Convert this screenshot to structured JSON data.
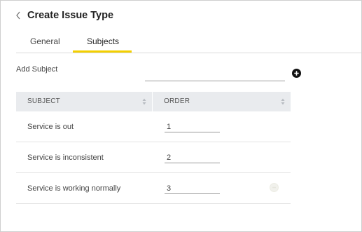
{
  "header": {
    "title": "Create Issue Type",
    "back_icon": "chevron-left-icon"
  },
  "tabs": [
    {
      "label": "General",
      "active": false
    },
    {
      "label": "Subjects",
      "active": true
    }
  ],
  "add_subject": {
    "label": "Add Subject",
    "value": "",
    "button_icon": "plus-circle-icon"
  },
  "table": {
    "headers": [
      "SUBJECT",
      "ORDER"
    ],
    "rows": [
      {
        "subject": "Service is out",
        "order": "1"
      },
      {
        "subject": "Service is inconsistent",
        "order": "2"
      },
      {
        "subject": "Service is working normally",
        "order": "3"
      }
    ]
  },
  "colors": {
    "accent": "#f4d000",
    "header_bg": "#e9ebee"
  }
}
